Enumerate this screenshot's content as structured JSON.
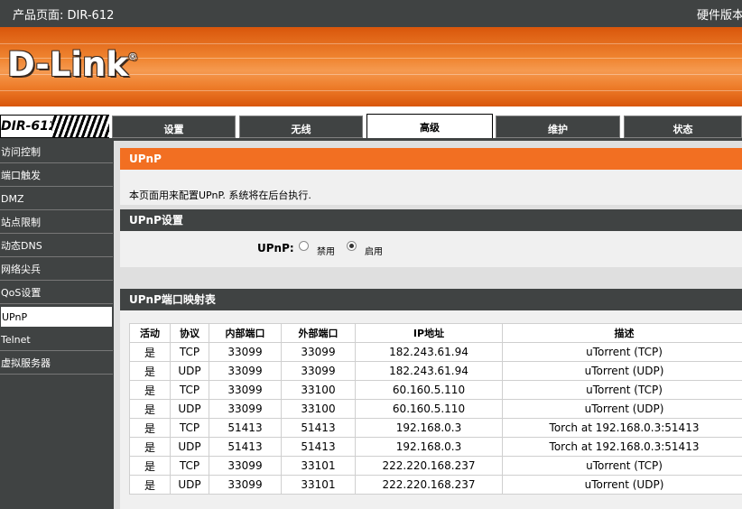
{
  "topbar": {
    "product_page": "产品页面: DIR-612",
    "hardware_version": "硬件版本"
  },
  "brand": {
    "logo_text": "D-Link",
    "registered_mark": "®"
  },
  "model": "DIR-612",
  "tabs": [
    {
      "label": "设置",
      "active": false
    },
    {
      "label": "无线",
      "active": false
    },
    {
      "label": "高级",
      "active": true
    },
    {
      "label": "维护",
      "active": false
    },
    {
      "label": "状态",
      "active": false
    }
  ],
  "sidebar": {
    "items": [
      {
        "label": "访问控制",
        "active": false
      },
      {
        "label": "端口触发",
        "active": false
      },
      {
        "label": "DMZ",
        "active": false
      },
      {
        "label": "站点限制",
        "active": false
      },
      {
        "label": "动态DNS",
        "active": false
      },
      {
        "label": "网络尖兵",
        "active": false
      },
      {
        "label": "QoS设置",
        "active": false
      },
      {
        "label": "UPnP",
        "active": true
      },
      {
        "label": "Telnet",
        "active": false
      },
      {
        "label": "虚拟服务器",
        "active": false
      }
    ]
  },
  "upnp_section": {
    "title": "UPnP",
    "description": "本页面用来配置UPnP. 系统将在后台执行."
  },
  "upnp_settings": {
    "title": "UPnP设置",
    "label": "UPnP:",
    "options": [
      {
        "label": "禁用",
        "selected": false
      },
      {
        "label": "启用",
        "selected": true
      }
    ]
  },
  "port_map": {
    "title": "UPnP端口映射表",
    "columns": [
      "活动",
      "协议",
      "内部端口",
      "外部端口",
      "IP地址",
      "描述"
    ],
    "rows": [
      [
        "是",
        "TCP",
        "33099",
        "33099",
        "182.243.61.94",
        "uTorrent (TCP)"
      ],
      [
        "是",
        "UDP",
        "33099",
        "33099",
        "182.243.61.94",
        "uTorrent (UDP)"
      ],
      [
        "是",
        "TCP",
        "33099",
        "33100",
        "60.160.5.110",
        "uTorrent (TCP)"
      ],
      [
        "是",
        "UDP",
        "33099",
        "33100",
        "60.160.5.110",
        "uTorrent (UDP)"
      ],
      [
        "是",
        "TCP",
        "51413",
        "51413",
        "192.168.0.3",
        "Torch at 192.168.0.3:51413"
      ],
      [
        "是",
        "UDP",
        "51413",
        "51413",
        "192.168.0.3",
        "Torch at 192.168.0.3:51413"
      ],
      [
        "是",
        "TCP",
        "33099",
        "33101",
        "222.220.168.237",
        "uTorrent (TCP)"
      ],
      [
        "是",
        "UDP",
        "33099",
        "33101",
        "222.220.168.237",
        "uTorrent (UDP)"
      ]
    ]
  },
  "colors": {
    "accent_orange": "#f26f22",
    "dark_gray": "#404343",
    "content_bg": "#dfdfdf"
  }
}
